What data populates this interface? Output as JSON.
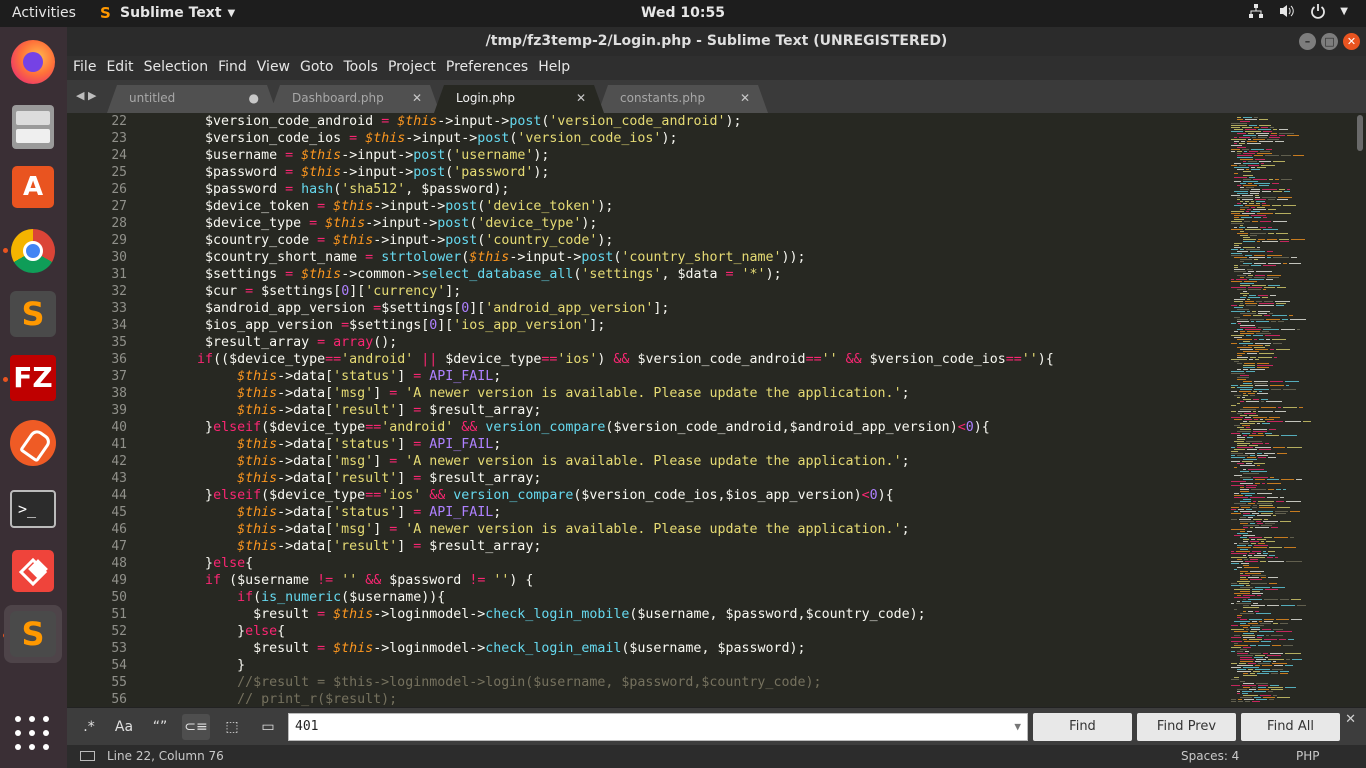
{
  "topbar": {
    "activities": "Activities",
    "app_name": "Sublime Text",
    "clock": "Wed 10:55"
  },
  "dock": {
    "items": [
      "firefox",
      "files",
      "software-store",
      "chrome",
      "sublime-text",
      "filezilla",
      "postman",
      "terminal",
      "anydesk",
      "sublime-text-active",
      "show-applications"
    ]
  },
  "window": {
    "title": "/tmp/fz3temp-2/Login.php - Sublime Text (UNREGISTERED)"
  },
  "menu": [
    "File",
    "Edit",
    "Selection",
    "Find",
    "View",
    "Goto",
    "Tools",
    "Project",
    "Preferences",
    "Help"
  ],
  "tabs": [
    {
      "label": "untitled",
      "marker": "●",
      "active": false
    },
    {
      "label": "Dashboard.php",
      "marker": "✕",
      "active": false
    },
    {
      "label": "Login.php",
      "marker": "✕",
      "active": true
    },
    {
      "label": "constants.php",
      "marker": "✕",
      "active": false
    }
  ],
  "editor": {
    "line_numbers": [
      "22",
      "23",
      "24",
      "25",
      "26",
      "27",
      "28",
      "29",
      "30",
      "31",
      "32",
      "33",
      "34",
      "35",
      "36",
      "37",
      "38",
      "39",
      "40",
      "41",
      "42",
      "43",
      "44",
      "45",
      "46",
      "47",
      "48",
      "49",
      "50",
      "51",
      "52",
      "53",
      "54",
      "55",
      "56"
    ],
    "code_lines": [
      "        $version_code_android = $this->input->post('version_code_android');",
      "        $version_code_ios = $this->input->post('version_code_ios');",
      "        $username = $this->input->post('username');",
      "        $password = $this->input->post('password');",
      "        $password = hash('sha512', $password);",
      "        $device_token = $this->input->post('device_token');",
      "        $device_type = $this->input->post('device_type');",
      "        $country_code = $this->input->post('country_code');",
      "        $country_short_name = strtolower($this->input->post('country_short_name'));",
      "        $settings = $this->common->select_database_all('settings', $data = '*');",
      "        $cur = $settings[0]['currency'];",
      "        $android_app_version =$settings[0]['android_app_version'];",
      "        $ios_app_version =$settings[0]['ios_app_version'];",
      "        $result_array = array();",
      "       if(($device_type=='android' || $device_type=='ios') && $version_code_android=='' && $version_code_ios==''){",
      "            $this->data['status'] = API_FAIL;",
      "            $this->data['msg'] = 'A newer version is available. Please update the application.';",
      "            $this->data['result'] = $result_array;",
      "        }elseif($device_type=='android' && version_compare($version_code_android,$android_app_version)<0){",
      "            $this->data['status'] = API_FAIL;",
      "            $this->data['msg'] = 'A newer version is available. Please update the application.';",
      "            $this->data['result'] = $result_array;",
      "        }elseif($device_type=='ios' && version_compare($version_code_ios,$ios_app_version)<0){",
      "            $this->data['status'] = API_FAIL;",
      "            $this->data['msg'] = 'A newer version is available. Please update the application.';",
      "            $this->data['result'] = $result_array;",
      "        }else{",
      "        if ($username != '' && $password != '') {",
      "            if(is_numeric($username)){",
      "              $result = $this->loginmodel->check_login_mobile($username, $password,$country_code);",
      "            }else{",
      "              $result = $this->loginmodel->check_login_email($username, $password);",
      "            }",
      "            //$result = $this->loginmodel->login($username, $password,$country_code);",
      "            // print_r($result);"
    ]
  },
  "find_panel": {
    "regex_label": ".*",
    "case_label": "Aa",
    "word_label": "“”",
    "wrap_label": "⊂≡",
    "selection_label": "⬚",
    "highlight_label": "▭",
    "query": "401",
    "find": "Find",
    "find_prev": "Find Prev",
    "find_all": "Find All",
    "close": "✕"
  },
  "status": {
    "position": "Line 22, Column 76",
    "indent": "Spaces: 4",
    "syntax": "PHP"
  },
  "colors": {
    "editor_bg": "#272822",
    "keyword": "#f92672",
    "string": "#e6db74",
    "function": "#66d9ef",
    "this": "#fd971f",
    "comment": "#75715e",
    "ubuntu_accent": "#e95420"
  }
}
